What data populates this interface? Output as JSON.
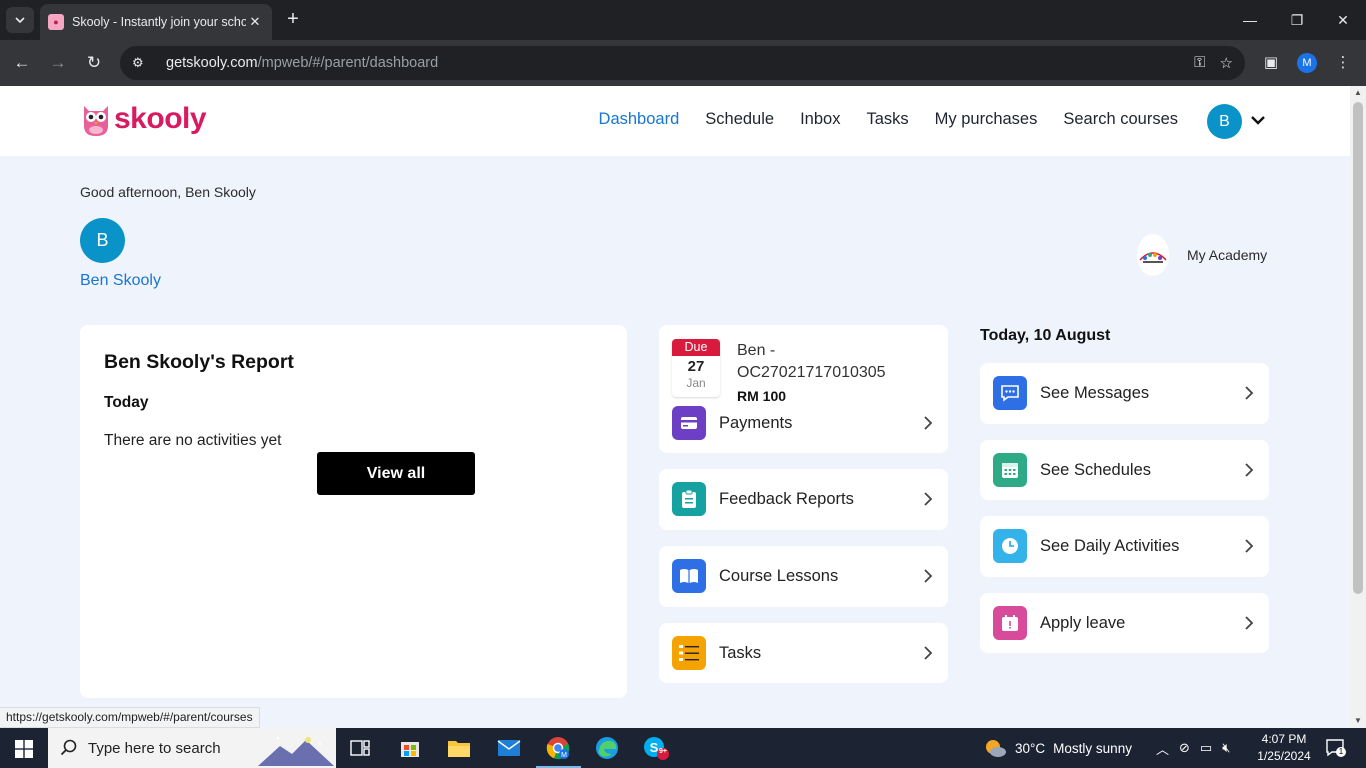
{
  "browser": {
    "tab_title": "Skooly - Instantly join your scho",
    "url_host": "getskooly.com",
    "url_path": "/mpweb/#/parent/dashboard",
    "profile_initial": "M",
    "status_url": "https://getskooly.com/mpweb/#/parent/courses"
  },
  "header": {
    "logo_text": "skooly",
    "nav": [
      "Dashboard",
      "Schedule",
      "Inbox",
      "Tasks",
      "My purchases",
      "Search courses"
    ],
    "avatar_initial": "B"
  },
  "profile": {
    "greeting": "Good afternoon, Ben Skooly",
    "avatar_initial": "B",
    "name": "Ben Skooly",
    "academy_name": "My Academy"
  },
  "report": {
    "title": "Ben Skooly's Report",
    "section": "Today",
    "empty_text": "There are no activities yet",
    "view_all": "View all"
  },
  "payment": {
    "due_label": "Due",
    "due_day": "27",
    "due_month": "Jan",
    "reference": "Ben - OC27021717010305",
    "amount": "RM 100",
    "label": "Payments"
  },
  "middle_cards": [
    "Feedback Reports",
    "Course Lessons",
    "Tasks"
  ],
  "today": {
    "date_label": "Today, 10 August",
    "items": [
      "See Messages",
      "See Schedules",
      "See Daily Activities",
      "Apply leave"
    ]
  },
  "colors": {
    "accent": "#1976d2",
    "brand": "#d81b60",
    "page_bg": "#eff3fb",
    "payments_icon": "#6c3fc4",
    "feedback_icon": "#17a2a2",
    "lessons_icon": "#2f6fe6",
    "tasks_icon": "#f5a300",
    "messages_icon": "#2f6fe6",
    "schedules_icon": "#2eaa86",
    "activities_icon": "#33b3ea",
    "leave_icon": "#d84a9a"
  },
  "taskbar": {
    "search_placeholder": "Type here to search",
    "temperature": "30°C",
    "weather": "Mostly sunny",
    "time": "4:07 PM",
    "date": "1/25/2024",
    "notifications": "1",
    "skype_badge": "9+"
  }
}
